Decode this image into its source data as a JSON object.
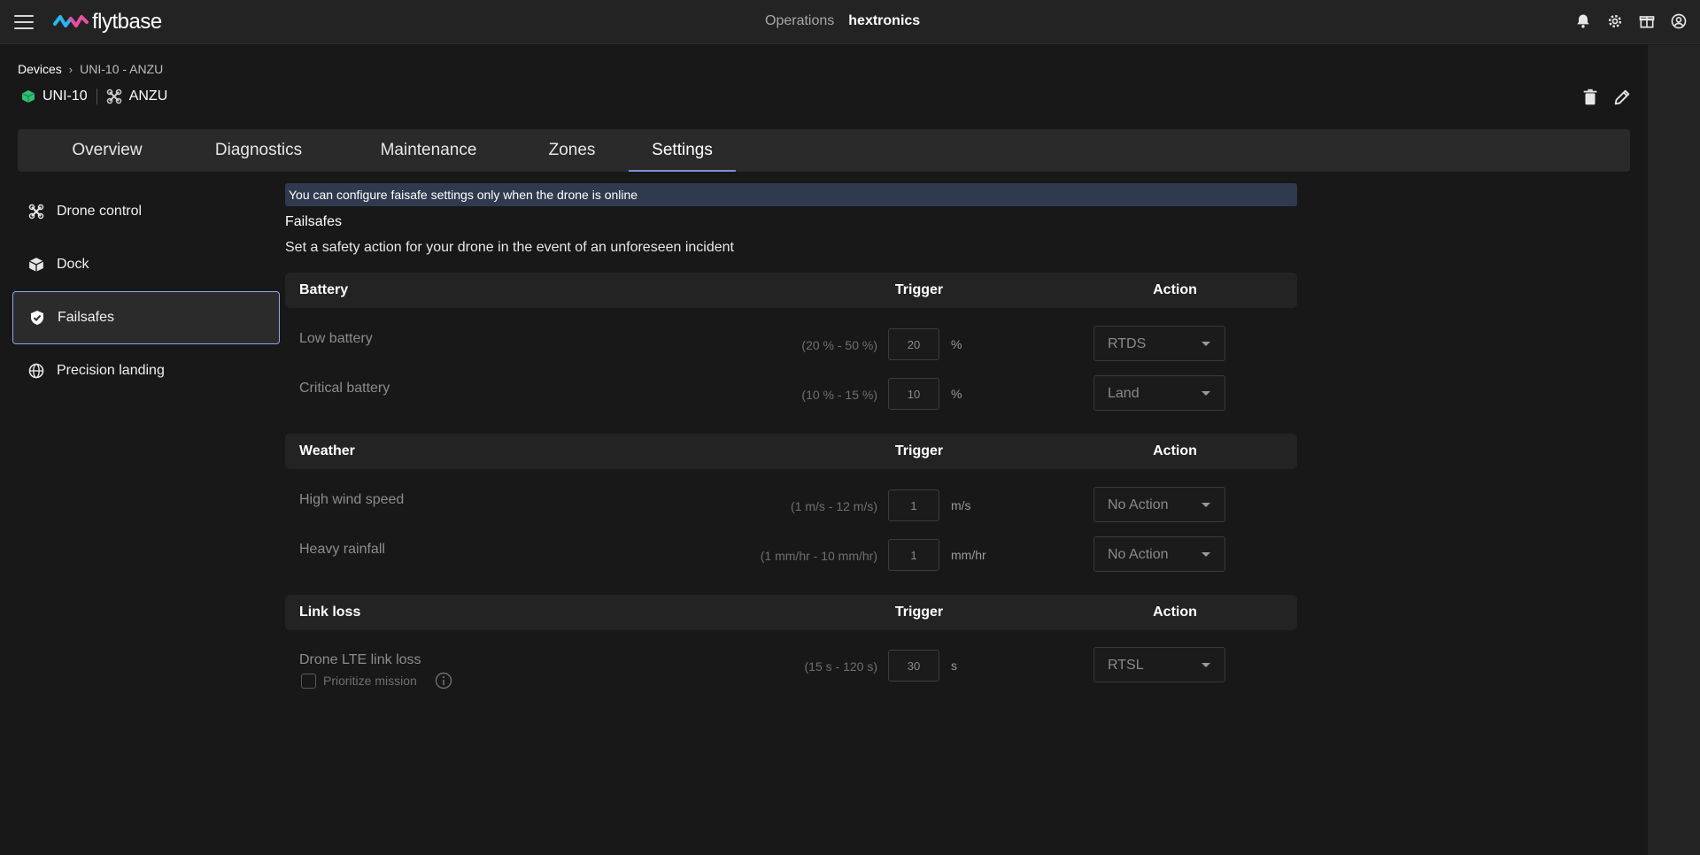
{
  "topbar": {
    "logo_text": "flytbase",
    "operations_label": "Operations",
    "org_name": "hextronics",
    "icons": [
      "bell-icon",
      "gear-icon",
      "gift-icon",
      "user-account-icon"
    ]
  },
  "breadcrumb": {
    "root": "Devices",
    "separator": "›",
    "current": "UNI-10 - ANZU"
  },
  "device": {
    "dock_name": "UNI-10",
    "drone_name": "ANZU",
    "dock_icon_color": "#2fbf71"
  },
  "tabs": [
    {
      "label": "Overview",
      "active": false
    },
    {
      "label": "Diagnostics",
      "active": false
    },
    {
      "label": "Maintenance",
      "active": false
    },
    {
      "label": "Zones",
      "active": false
    },
    {
      "label": "Settings",
      "active": true
    }
  ],
  "sidenav": [
    {
      "label": "Drone control",
      "icon": "drone-icon",
      "active": false
    },
    {
      "label": "Dock",
      "icon": "dock-cube-icon",
      "active": false
    },
    {
      "label": "Failsafes",
      "icon": "shield-icon",
      "active": true
    },
    {
      "label": "Precision landing",
      "icon": "globe-icon",
      "active": false
    }
  ],
  "content": {
    "banner": "You can configure faisafe settings only when the drone is online",
    "title": "Failsafes",
    "description": "Set a safety action for your drone in the event of an unforeseen incident",
    "trigger_header": "Trigger",
    "action_header": "Action",
    "groups": [
      {
        "name": "Battery",
        "rows": [
          {
            "label": "Low battery",
            "range": "(20 % - 50 %)",
            "value": "20",
            "unit": "%",
            "action": "RTDS"
          },
          {
            "label": "Critical battery",
            "range": "(10 % - 15 %)",
            "value": "10",
            "unit": "%",
            "action": "Land"
          }
        ]
      },
      {
        "name": "Weather",
        "rows": [
          {
            "label": "High wind speed",
            "range": "(1 m/s - 12 m/s)",
            "value": "1",
            "unit": "m/s",
            "action": "No Action"
          },
          {
            "label": "Heavy rainfall",
            "range": "(1 mm/hr - 10 mm/hr)",
            "value": "1",
            "unit": "mm/hr",
            "action": "No Action"
          }
        ]
      },
      {
        "name": "Link loss",
        "rows": [
          {
            "label": "Drone LTE link loss",
            "range": "(15 s - 120 s)",
            "value": "30",
            "unit": "s",
            "action": "RTSL"
          }
        ]
      }
    ],
    "prioritize_mission_label": "Prioritize mission",
    "prioritize_mission_checked": false
  },
  "colors": {
    "accent": "#8ea6ec",
    "tab_underline": "#7d8fd4",
    "banner_bg": "#2f3a4e"
  }
}
